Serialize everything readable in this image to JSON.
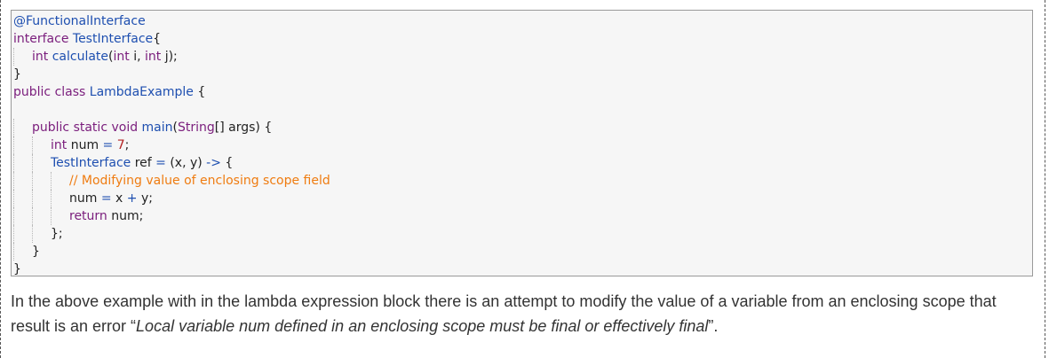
{
  "code": {
    "lines": [
      {
        "indent": 0,
        "tokens": [
          {
            "t": "an",
            "v": "@FunctionalInterface"
          }
        ]
      },
      {
        "indent": 0,
        "tokens": [
          {
            "t": "kw",
            "v": "interface "
          },
          {
            "t": "ty",
            "v": "TestInterface"
          },
          {
            "t": "pl",
            "v": "{"
          }
        ]
      },
      {
        "indent": 1,
        "tokens": [
          {
            "t": "kw",
            "v": "int "
          },
          {
            "t": "ty",
            "v": "calculate"
          },
          {
            "t": "pl",
            "v": "("
          },
          {
            "t": "kw",
            "v": "int "
          },
          {
            "t": "pl",
            "v": "i, "
          },
          {
            "t": "kw",
            "v": "int "
          },
          {
            "t": "pl",
            "v": "j);"
          }
        ]
      },
      {
        "indent": 0,
        "tokens": [
          {
            "t": "pl",
            "v": "}"
          }
        ]
      },
      {
        "indent": 0,
        "tokens": [
          {
            "t": "kw",
            "v": "public class "
          },
          {
            "t": "ty",
            "v": "LambdaExample"
          },
          {
            "t": "pl",
            "v": " {"
          }
        ]
      },
      {
        "indent": 0,
        "tokens": []
      },
      {
        "indent": 1,
        "tokens": [
          {
            "t": "kw",
            "v": "public static void "
          },
          {
            "t": "ty",
            "v": "main"
          },
          {
            "t": "pl",
            "v": "("
          },
          {
            "t": "kw",
            "v": "String"
          },
          {
            "t": "pl",
            "v": "[] args) {"
          }
        ]
      },
      {
        "indent": 2,
        "tokens": [
          {
            "t": "kw",
            "v": "int "
          },
          {
            "t": "pl",
            "v": "num "
          },
          {
            "t": "op",
            "v": "="
          },
          {
            "t": "pl",
            "v": " "
          },
          {
            "t": "num",
            "v": "7"
          },
          {
            "t": "pl",
            "v": ";"
          }
        ]
      },
      {
        "indent": 2,
        "tokens": [
          {
            "t": "ty",
            "v": "TestInterface"
          },
          {
            "t": "pl",
            "v": " ref "
          },
          {
            "t": "op",
            "v": "="
          },
          {
            "t": "pl",
            "v": " (x, y) "
          },
          {
            "t": "op",
            "v": "->"
          },
          {
            "t": "pl",
            "v": " {"
          }
        ]
      },
      {
        "indent": 3,
        "tokens": [
          {
            "t": "cm",
            "v": "// Modifying value of enclosing scope field"
          }
        ]
      },
      {
        "indent": 3,
        "tokens": [
          {
            "t": "pl",
            "v": "num "
          },
          {
            "t": "op",
            "v": "="
          },
          {
            "t": "pl",
            "v": " x "
          },
          {
            "t": "op",
            "v": "+"
          },
          {
            "t": "pl",
            "v": " y;"
          }
        ]
      },
      {
        "indent": 3,
        "tokens": [
          {
            "t": "kw",
            "v": "return "
          },
          {
            "t": "pl",
            "v": "num;"
          }
        ]
      },
      {
        "indent": 2,
        "tokens": [
          {
            "t": "pl",
            "v": "};"
          }
        ]
      },
      {
        "indent": 1,
        "tokens": [
          {
            "t": "pl",
            "v": "}"
          }
        ]
      },
      {
        "indent": 0,
        "tokens": [
          {
            "t": "pl",
            "v": "}"
          }
        ]
      }
    ]
  },
  "explanation": {
    "before": "In the above example with in the lambda expression block there is an attempt to modify the value of a variable from an enclosing scope that result is an error “",
    "error_message": "Local variable num defined in an enclosing scope must be final or effectively final",
    "after": "”."
  }
}
